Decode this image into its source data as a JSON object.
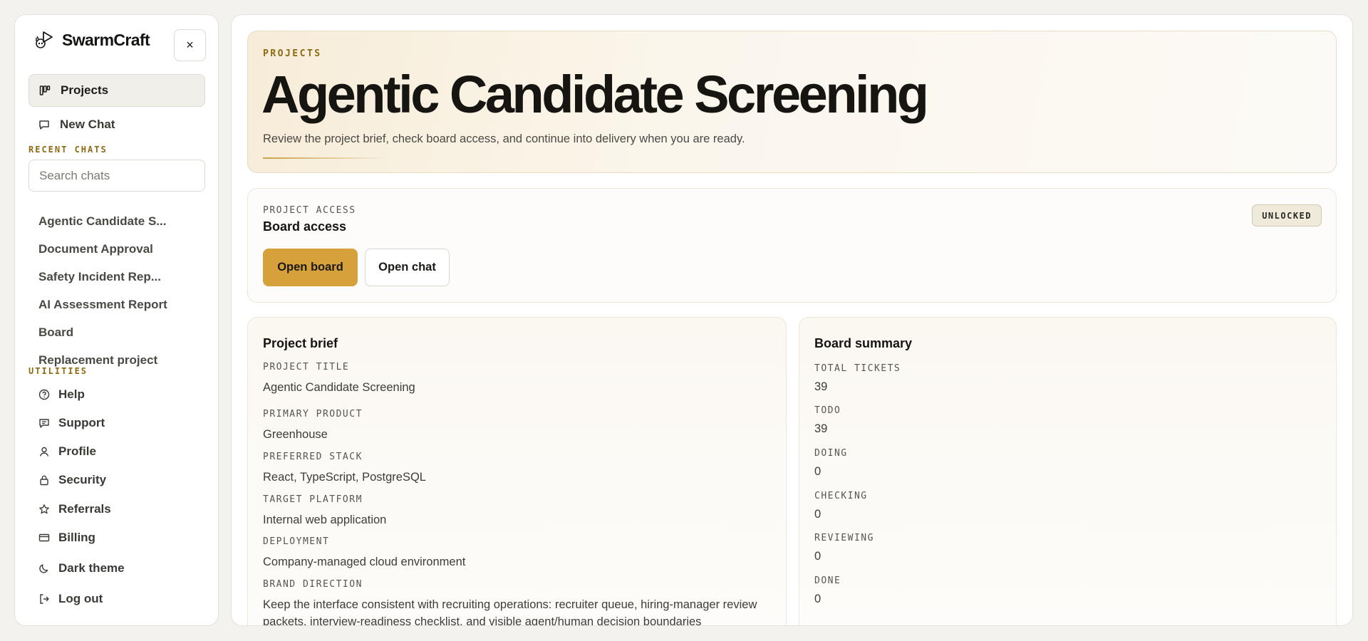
{
  "app": {
    "name": "SwarmCraft",
    "close_glyph": "×"
  },
  "nav": {
    "projects": "Projects",
    "new_chat": "New Chat"
  },
  "recent_chats": {
    "label": "RECENT CHATS",
    "search_placeholder": "Search chats",
    "items": [
      "Agentic Candidate S...",
      "Document Approval",
      "Safety Incident Rep...",
      "AI Assessment Report",
      "Board",
      "Replacement project"
    ]
  },
  "utilities": {
    "label": "UTILITIES",
    "help": "Help",
    "support": "Support",
    "profile": "Profile",
    "security": "Security",
    "referrals": "Referrals",
    "billing": "Billing",
    "dark_theme": "Dark theme",
    "log_out": "Log out"
  },
  "hero": {
    "eyebrow": "PROJECTS",
    "title": "Agentic Candidate Screening",
    "subtitle": "Review the project brief, check board access, and continue into delivery when you are ready."
  },
  "access": {
    "label": "PROJECT ACCESS",
    "title": "Board access",
    "badge": "UNLOCKED",
    "open_board": "Open board",
    "open_chat": "Open chat"
  },
  "brief": {
    "title": "Project brief",
    "project_title_label": "PROJECT TITLE",
    "project_title": "Agentic Candidate Screening",
    "primary_product_label": "PRIMARY PRODUCT",
    "primary_product": "Greenhouse",
    "preferred_stack_label": "PREFERRED STACK",
    "preferred_stack": "React, TypeScript, PostgreSQL",
    "target_platform_label": "TARGET PLATFORM",
    "target_platform": "Internal web application",
    "deployment_label": "DEPLOYMENT",
    "deployment": "Company-managed cloud environment",
    "brand_direction_label": "BRAND DIRECTION",
    "brand_direction": "Keep the interface consistent with recruiting operations: recruiter queue, hiring-manager review packets, interview-readiness checklist, and visible agent/human decision boundaries"
  },
  "summary": {
    "title": "Board summary",
    "total_label": "TOTAL TICKETS",
    "total": "39",
    "todo_label": "TODO",
    "todo": "39",
    "doing_label": "DOING",
    "doing": "0",
    "checking_label": "CHECKING",
    "checking": "0",
    "reviewing_label": "REVIEWING",
    "reviewing": "0",
    "done_label": "DONE",
    "done": "0"
  },
  "colors": {
    "accent": "#d6a13a",
    "eyebrow": "#8d6a12",
    "page_bg": "#f3f2ee"
  },
  "icons": {
    "projects": "kanban-icon",
    "new_chat": "chat-bubble-icon",
    "help": "help-circle-icon",
    "support": "message-icon",
    "profile": "user-icon",
    "security": "lock-icon",
    "referrals": "star-icon",
    "billing": "credit-card-icon",
    "dark_theme": "moon-icon",
    "log_out": "log-out-icon"
  }
}
